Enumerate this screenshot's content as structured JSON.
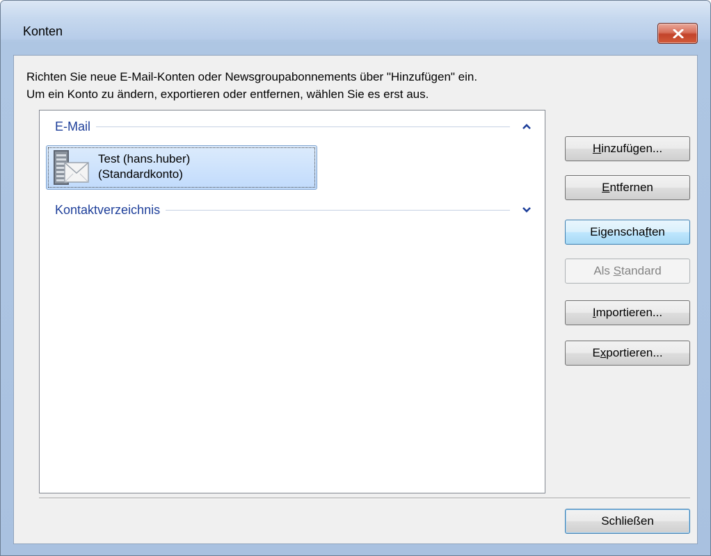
{
  "window": {
    "title": "Konten"
  },
  "instructions": {
    "line1": "Richten Sie neue E-Mail-Konten oder Newsgroupabonnements über \"Hinzufügen\" ein.",
    "line2": "Um ein Konto zu ändern, exportieren oder entfernen, wählen Sie es erst aus."
  },
  "groups": [
    {
      "label": "E-Mail",
      "state": "expanded",
      "items": [
        {
          "name_line": "Test (hans.huber)",
          "default_line": "(Standardkonto)",
          "icon": "mail-server-icon",
          "selected": true
        }
      ]
    },
    {
      "label": "Kontaktverzeichnis",
      "state": "collapsed",
      "items": []
    }
  ],
  "buttons": {
    "add": {
      "pre": "",
      "u": "H",
      "post": "inzufügen...",
      "state": "normal"
    },
    "remove": {
      "pre": "",
      "u": "E",
      "post": "ntfernen",
      "state": "normal"
    },
    "properties": {
      "pre": "Eigenscha",
      "u": "f",
      "post": "ten",
      "state": "hover"
    },
    "set_default": {
      "pre": "Als ",
      "u": "S",
      "post": "tandard",
      "state": "disabled"
    },
    "import": {
      "pre": "",
      "u": "I",
      "post": "mportieren...",
      "state": "normal"
    },
    "export": {
      "pre": "E",
      "u": "x",
      "post": "portieren...",
      "state": "normal"
    },
    "close": {
      "label": "Schließen",
      "state": "default"
    }
  },
  "colors": {
    "group_header": "#1e3f9a",
    "selection": "#c1dbfc",
    "close_button": "#c2432a"
  }
}
